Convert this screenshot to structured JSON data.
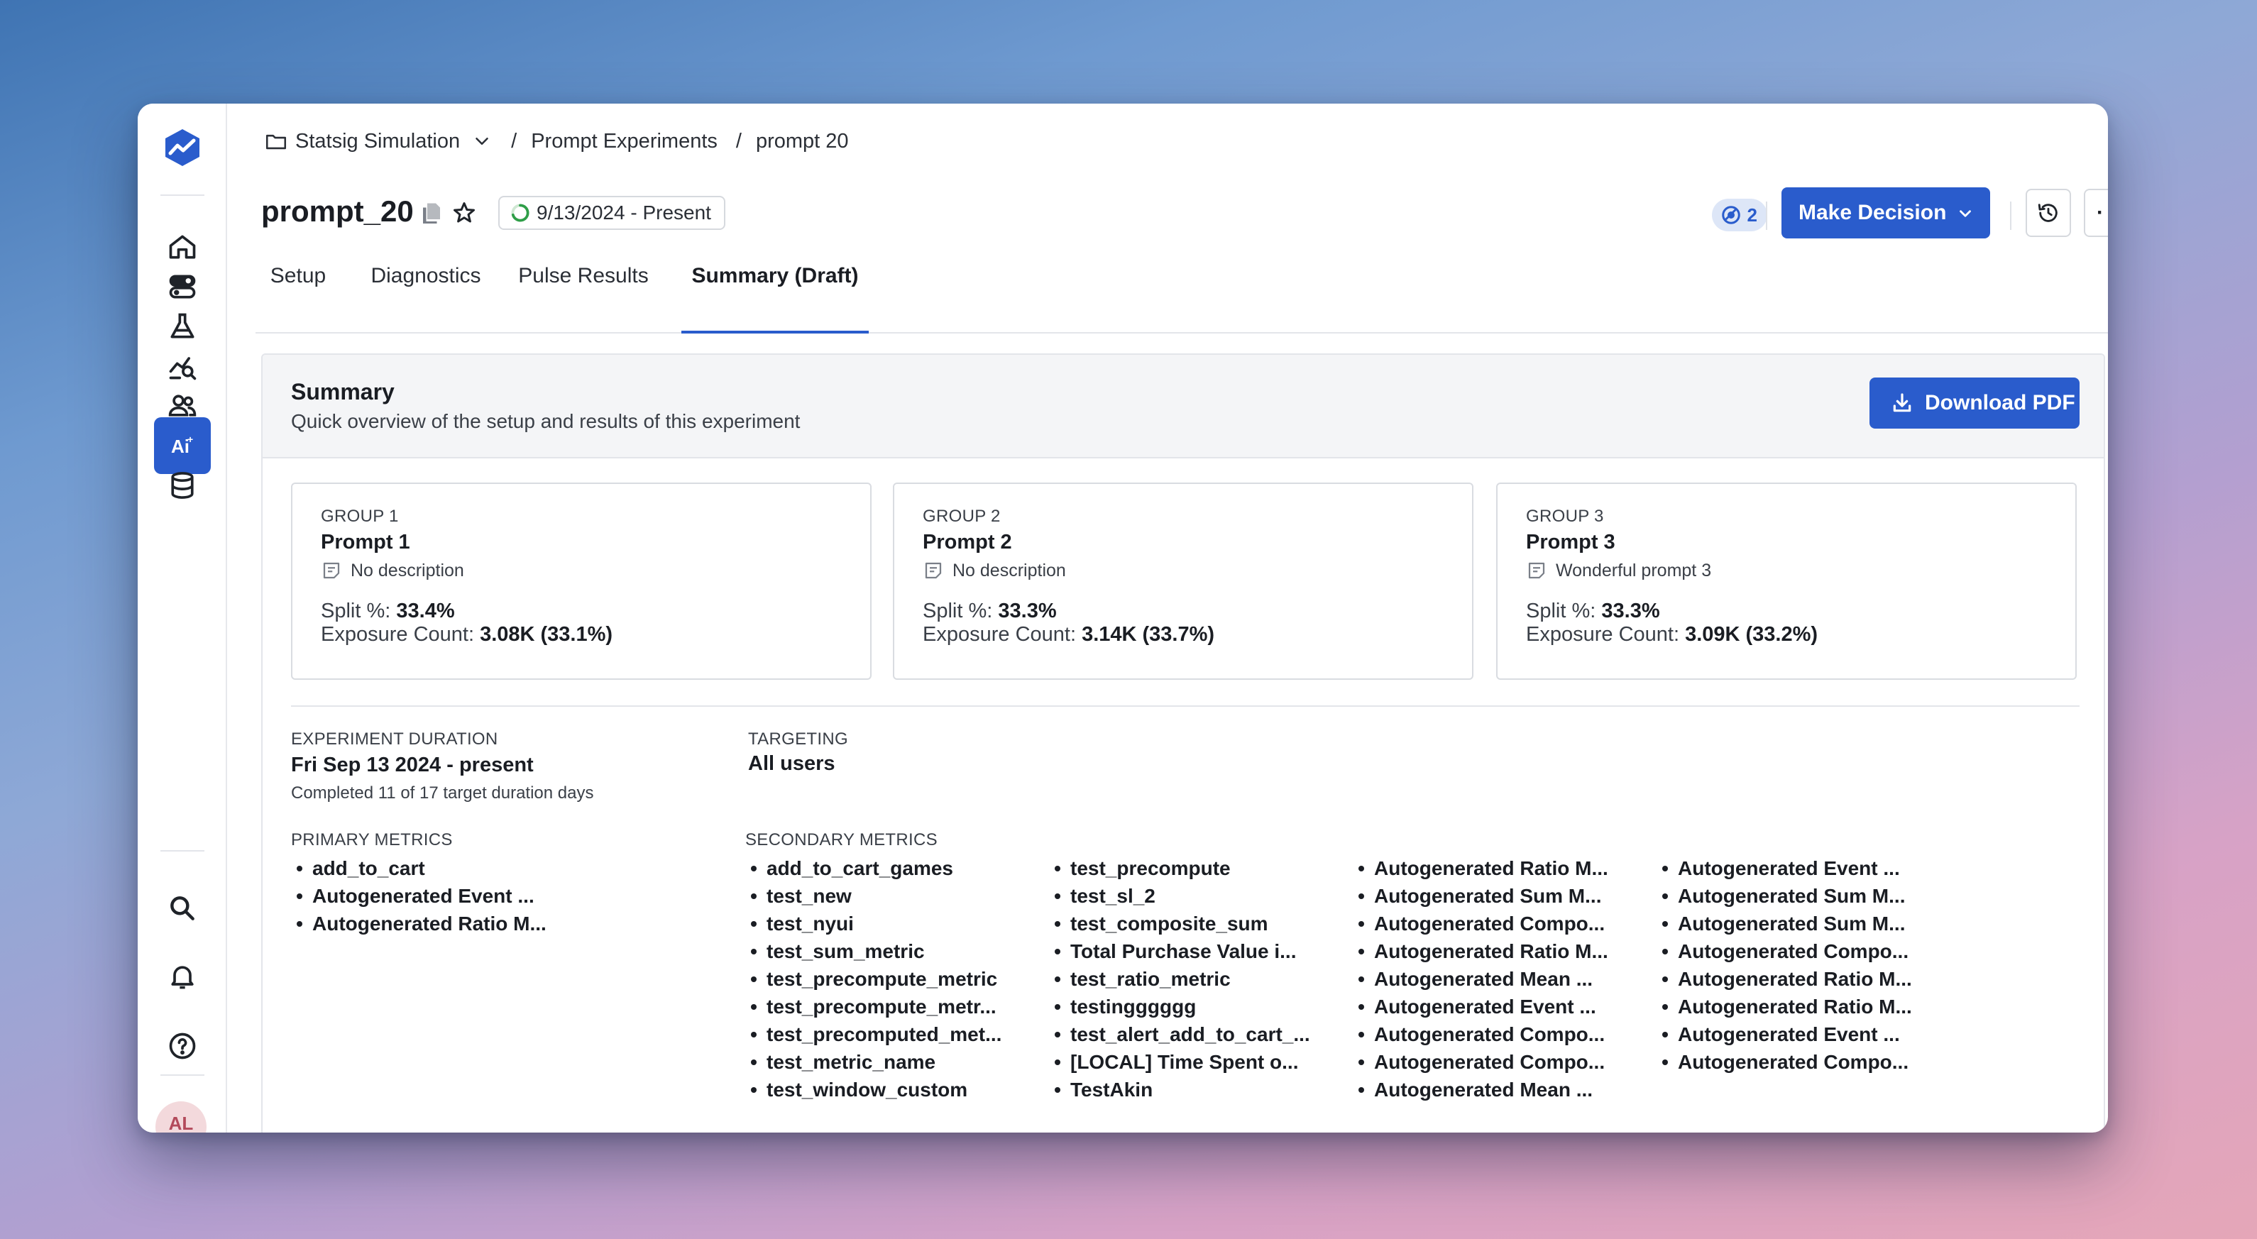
{
  "breadcrumb": {
    "project": "Statsig Simulation",
    "section": "Prompt Experiments",
    "page": "prompt 20"
  },
  "experiment": {
    "name": "prompt_20",
    "date_range": "9/13/2024 - Present",
    "reviewers_count": "2"
  },
  "actions": {
    "make_decision": "Make Decision",
    "more": "·"
  },
  "tabs": [
    {
      "label": "Setup"
    },
    {
      "label": "Diagnostics"
    },
    {
      "label": "Pulse Results"
    },
    {
      "label": "Summary (Draft)",
      "active": true
    }
  ],
  "summary": {
    "title": "Summary",
    "subtitle": "Quick overview of the setup and results of this experiment",
    "download_label": "Download PDF",
    "groups": [
      {
        "label": "GROUP 1",
        "name": "Prompt 1",
        "description": "No description",
        "split_label": "Split %:",
        "split": "33.4%",
        "exposure_label": "Exposure Count:",
        "exposure": "3.08K (33.1%)"
      },
      {
        "label": "GROUP 2",
        "name": "Prompt 2",
        "description": "No description",
        "split_label": "Split %:",
        "split": "33.3%",
        "exposure_label": "Exposure Count:",
        "exposure": "3.14K (33.7%)"
      },
      {
        "label": "GROUP 3",
        "name": "Prompt 3",
        "description": "Wonderful prompt 3",
        "split_label": "Split %:",
        "split": "33.3%",
        "exposure_label": "Exposure Count:",
        "exposure": "3.09K (33.2%)"
      }
    ],
    "duration": {
      "label": "EXPERIMENT DURATION",
      "value": "Fri Sep 13 2024 - present",
      "note": "Completed 11 of 17 target duration days"
    },
    "targeting": {
      "label": "TARGETING",
      "value": "All users"
    },
    "primary_metrics": {
      "label": "PRIMARY METRICS",
      "items": [
        "add_to_cart",
        "Autogenerated Event ...",
        "Autogenerated Ratio M..."
      ]
    },
    "secondary_metrics": {
      "label": "SECONDARY METRICS",
      "columns": [
        [
          "add_to_cart_games",
          "test_new",
          "test_nyui",
          "test_sum_metric",
          "test_precompute_metric",
          "test_precompute_metr...",
          "test_precomputed_met...",
          "test_metric_name",
          "test_window_custom"
        ],
        [
          "test_precompute",
          "test_sl_2",
          "test_composite_sum",
          "Total Purchase Value i...",
          "test_ratio_metric",
          "testingggggg",
          "test_alert_add_to_cart_...",
          "[LOCAL] Time Spent o...",
          "TestAkin"
        ],
        [
          "Autogenerated Ratio M...",
          "Autogenerated Sum M...",
          "Autogenerated Compo...",
          "Autogenerated Ratio M...",
          "Autogenerated Mean ...",
          "Autogenerated Event ...",
          "Autogenerated Compo...",
          "Autogenerated Compo...",
          "Autogenerated Mean ..."
        ],
        [
          "Autogenerated Event ...",
          "Autogenerated Sum M...",
          "Autogenerated Sum M...",
          "Autogenerated Compo...",
          "Autogenerated Ratio M...",
          "Autogenerated Ratio M...",
          "Autogenerated Event ...",
          "Autogenerated Compo..."
        ]
      ]
    }
  },
  "user": {
    "initials": "AL"
  },
  "colors": {
    "accent": "#2a5ccc",
    "badge_bg": "#dde6f7",
    "panel_bg": "#f4f5f7"
  }
}
